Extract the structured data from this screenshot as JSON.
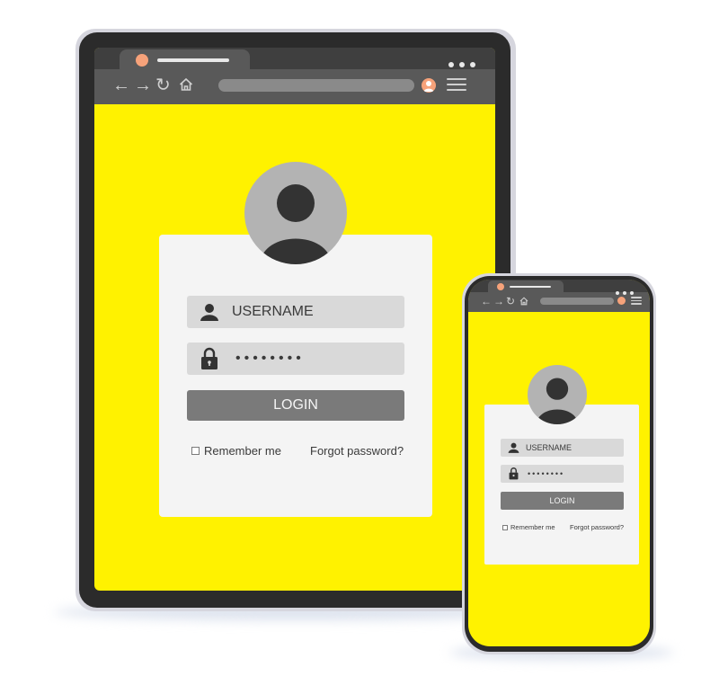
{
  "colors": {
    "screen_background": "#fff200",
    "device_frame": "#2b2b2b",
    "browser_chrome": "#595959",
    "card": "#f4f4f4",
    "field": "#d9d9d9",
    "login_button": "#7a7a7a",
    "avatar_accent": "#f6a27a"
  },
  "icons": {
    "back": "←",
    "forward": "→",
    "reload": "↻",
    "home": "home-icon",
    "user": "user-icon",
    "lock": "lock-icon",
    "menu": "hamburger-menu-icon"
  },
  "tablet": {
    "username_label": "USERNAME",
    "password_mask": "••••••••",
    "login_label": "LOGIN",
    "remember_label": "Remember me",
    "forgot_label": "Forgot password?"
  },
  "phone": {
    "username_label": "USERNAME",
    "password_mask": "••••••••",
    "login_label": "LOGIN",
    "remember_label": "Remember me",
    "forgot_label": "Forgot password?"
  }
}
